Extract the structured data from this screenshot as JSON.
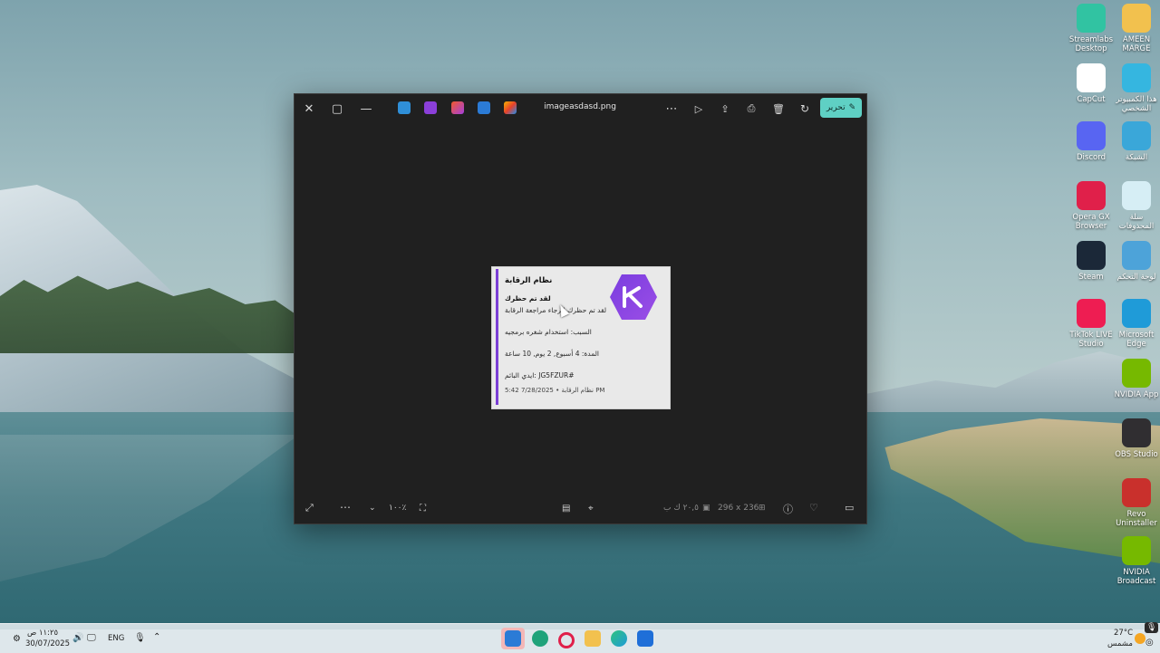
{
  "desktop": {
    "icons": [
      {
        "label": "Streamlabs\nDesktop",
        "icon": "streamlabs-icon",
        "color": "#31c3a2"
      },
      {
        "label": "AMEEN\nMARGE",
        "icon": "folder-icon",
        "color": "#f2c14e"
      },
      {
        "label": "CapCut",
        "icon": "capcut-icon",
        "color": "#ffffff"
      },
      {
        "label": "هذا الكمبيوتر\nالشخصي",
        "icon": "this-pc-icon",
        "color": "#35b6e0"
      },
      {
        "label": "Discord",
        "icon": "discord-icon",
        "color": "#5865f2"
      },
      {
        "label": "الشبكة",
        "icon": "network-icon",
        "color": "#3aa7d9"
      },
      {
        "label": "Opera GX\nBrowser",
        "icon": "opera-gx-icon",
        "color": "#e0204a"
      },
      {
        "label": "سلة\nالمحذوفات",
        "icon": "recycle-bin-icon",
        "color": "#d6eef5"
      },
      {
        "label": "Steam",
        "icon": "steam-icon",
        "color": "#1b2838"
      },
      {
        "label": "لوحة التحكم",
        "icon": "control-panel-icon",
        "color": "#4da3d9"
      },
      {
        "label": "TikTok LIVE\nStudio",
        "icon": "tiktok-live-icon",
        "color": "#ee1d52"
      },
      {
        "label": "Microsoft\nEdge",
        "icon": "edge-icon",
        "color": "#1f9bd8"
      },
      {
        "label": "NVIDIA App",
        "icon": "nvidia-app-icon",
        "color": "#76b900"
      },
      {
        "label": "OBS Studio",
        "icon": "obs-icon",
        "color": "#302e31"
      },
      {
        "label": "Revo\nUninstaller",
        "icon": "revo-uninstaller-icon",
        "color": "#c9302c"
      },
      {
        "label": "NVIDIA\nBroadcast",
        "icon": "nvidia-broadcast-icon",
        "color": "#76b900"
      }
    ]
  },
  "photos": {
    "filename": "imageasdasd.png",
    "edit_label": "تحرير",
    "zoom": "١٠٠٪",
    "file_size": "٢٠,٥ ك ب",
    "dimensions": "296 x 236",
    "accent": "#5fd0c4"
  },
  "image": {
    "title": "نظام الرقابة",
    "subtitle": "لقد تم حظرك",
    "description": "لقد تم حظرك الرجاء مراجعة الرقابة",
    "reason": "السبب: استخدام شغره برمجيه",
    "duration": "المدة: 4 أسبوع, 2 يوم, 10 ساعة",
    "reporter_id": "ايدي البائم: JG5FZUR#",
    "footer": "نظام الرقابة • 7/28/2025 5:42 PM",
    "brand_color": "#7b3fd6"
  },
  "taskbar": {
    "time": "١١:٢٥ ص",
    "date": "30/07/2025",
    "lang": "ENG",
    "temp": "27°C",
    "weather": "مشمس"
  }
}
